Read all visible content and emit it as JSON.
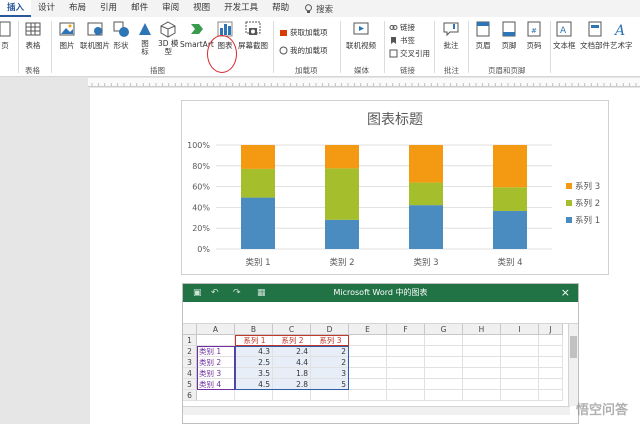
{
  "tabs": [
    "插入",
    "设计",
    "布局",
    "引用",
    "邮件",
    "审阅",
    "视图",
    "开发工具",
    "帮助"
  ],
  "search_label": "搜索",
  "ribbon": {
    "pages_label": "页",
    "table_label": "表格",
    "table_group": "表格",
    "picture": "图片",
    "online_picture": "联机图片",
    "shapes": "形状",
    "icons": "图\n标",
    "models3d": "3D 模\n型",
    "smartart": "SmartArt",
    "chart": "图表",
    "screenshot": "屏幕截图",
    "illustrations_group": "插图",
    "get_addins": "获取加载项",
    "my_addins": "我的加载项",
    "addins_group": "加载项",
    "online_video": "联机视频",
    "media_group": "媒体",
    "link": "链接",
    "bookmark": "书签",
    "cross_ref": "交叉引用",
    "links_group": "链接",
    "comment": "批注",
    "comments_group": "批注",
    "header": "页眉",
    "footer": "页脚",
    "page_number": "页码",
    "hf_group": "页眉和页脚",
    "textbox": "文本框",
    "doc_parts": "文档部件",
    "wordart": "艺术字"
  },
  "chart_data": {
    "type": "bar",
    "stacked": "percent",
    "title": "图表标题",
    "categories": [
      "类别 1",
      "类别 2",
      "类别 3",
      "类别 4"
    ],
    "series": [
      {
        "name": "系列 1",
        "values": [
          4.3,
          2.5,
          3.5,
          4.5
        ],
        "color": "#4a8cbf"
      },
      {
        "name": "系列 2",
        "values": [
          2.4,
          4.4,
          1.8,
          2.8
        ],
        "color": "#a4be2c"
      },
      {
        "name": "系列 3",
        "values": [
          2,
          2,
          3,
          5
        ],
        "color": "#f39a12"
      }
    ],
    "y_ticks": [
      "0%",
      "20%",
      "40%",
      "60%",
      "80%",
      "100%"
    ],
    "ylim": [
      0,
      100
    ],
    "legend_position": "right",
    "grid": true
  },
  "excel": {
    "title": "Microsoft Word 中的图表",
    "columns": [
      "A",
      "B",
      "C",
      "D",
      "E",
      "F",
      "G",
      "H",
      "I",
      "J"
    ],
    "rows": [
      [
        "",
        "系列 1",
        "系列 2",
        "系列 3"
      ],
      [
        "类别 1",
        "4.3",
        "2.4",
        "2"
      ],
      [
        "类别 2",
        "2.5",
        "4.4",
        "2"
      ],
      [
        "类别 3",
        "3.5",
        "1.8",
        "3"
      ],
      [
        "类别 4",
        "4.5",
        "2.8",
        "5"
      ],
      [
        "",
        "",
        "",
        ""
      ]
    ],
    "row_numbers": [
      "1",
      "2",
      "3",
      "4",
      "5",
      "6"
    ]
  },
  "watermark": "悟空问答"
}
